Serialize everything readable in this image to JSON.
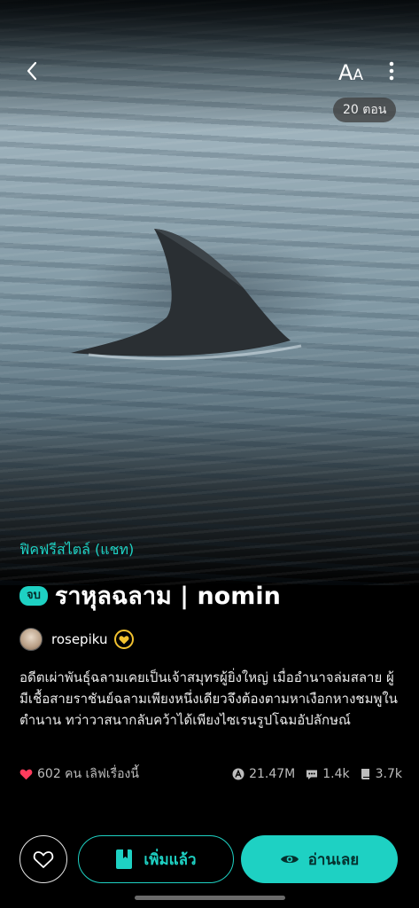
{
  "header": {
    "font_size_label_large": "A",
    "font_size_label_small": "A",
    "episode_count": "20 ตอน"
  },
  "story": {
    "genre": "ฟิคฟรีสไตล์ (แชท)",
    "status_badge": "จบ",
    "title": "ราหุลฉลาม | nomin",
    "author": "rosepiku",
    "synopsis": "อดีตเผ่าพันธุ์ฉลามเคยเป็นเจ้าสมุทรผู้ยิ่งใหญ่ เมื่ออำนาจล่มสลาย ผู้มีเชื้อสายราชันย์ฉลามเพียงหนึ่งเดียวจึงต้องตามหาเงือกหางชมพูในตำนาน ทว่าวาสนากลับคว้าได้เพียงไซเรนรูปโฉมอัปลักษณ์"
  },
  "stats": {
    "likes_text": "602 คน เลิฟเรื่องนี้",
    "views": "21.47M",
    "comments": "1.4k",
    "chapters": "3.7k"
  },
  "actions": {
    "library_label": "เพิ่มแล้ว",
    "read_label": "อ่านเลย"
  },
  "colors": {
    "accent": "#1ed1c3",
    "like_heart": "#ff3b5c",
    "author_badge": "#f2c230"
  },
  "icons": {
    "back": "chevron-left-icon",
    "font": "font-size-icon",
    "more": "more-vertical-icon",
    "heart": "heart-icon",
    "bookmark": "bookmark-icon",
    "eye": "eye-icon",
    "views": "views-icon",
    "comments": "comment-icon",
    "chapters": "book-icon"
  }
}
